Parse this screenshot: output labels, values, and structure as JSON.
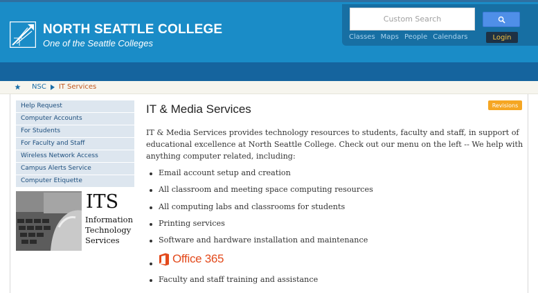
{
  "header": {
    "college_name": "NORTH SEATTLE COLLEGE",
    "tagline": "One of the Seattle Colleges"
  },
  "search": {
    "placeholder": "Custom Search",
    "button_icon": "search-icon"
  },
  "quick_links": [
    "Classes",
    "Maps",
    "People",
    "Calendars"
  ],
  "login_label": "Login",
  "breadcrumb": {
    "home_icon": "star-icon",
    "items": [
      "NSC",
      "IT Services"
    ]
  },
  "sidebar": {
    "items": [
      {
        "label": "Help Request"
      },
      {
        "label": "Computer Accounts"
      },
      {
        "label": "For Students"
      },
      {
        "label": "For Faculty and Staff"
      },
      {
        "label": "Wireless Network Access"
      },
      {
        "label": "Campus Alerts Service"
      },
      {
        "label": "Computer Etiquette"
      }
    ],
    "its_banner": {
      "big": "ITS",
      "lines": [
        "Information",
        "Technology",
        "Services"
      ]
    }
  },
  "main": {
    "title": "IT & Media Services",
    "revisions_label": "Revisions",
    "intro": "IT & Media Services provides technology resources to students, faculty and staff, in support of educational excellence at North Seattle College. Check out our menu on the left -- We help with anything computer related, including:",
    "services": [
      "Email account setup and creation",
      "All classroom and meeting space computing resources",
      "All computing labs and classrooms for students",
      "Printing services",
      "Software and hardware installation and maintenance"
    ],
    "office_logo_text": "Office 365",
    "services_after": [
      "Faculty and staff training and assistance"
    ]
  },
  "colors": {
    "header_blue": "#1a8cc7",
    "nav_blue": "#15649e",
    "accent_orange": "#f5a623",
    "office_red": "#e34a1c"
  }
}
